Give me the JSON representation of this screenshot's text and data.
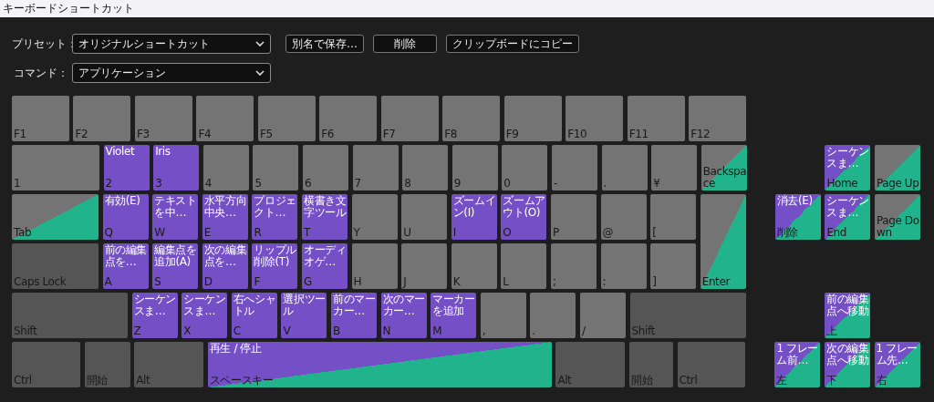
{
  "window": {
    "title": "キーボードショートカット"
  },
  "preset": {
    "label": "プリセット：",
    "value": "オリジナルショートカット"
  },
  "buttons": [
    "別名で保存…",
    "削除",
    "クリップボードにコピー"
  ],
  "command": {
    "label": "コマンド：",
    "value": "アプリケーション"
  },
  "keyboard": {
    "rows": [
      {
        "keys": [
          {
            "key": "F1",
            "kind": "plain"
          },
          {
            "key": "F2",
            "kind": "plain"
          },
          {
            "key": "F3",
            "kind": "plain"
          },
          {
            "key": "F4",
            "kind": "plain"
          },
          {
            "key": "F5",
            "kind": "plain"
          },
          {
            "key": "F6",
            "kind": "plain"
          },
          {
            "key": "F7",
            "kind": "plain"
          },
          {
            "key": "F8",
            "kind": "plain"
          },
          {
            "key": "F9",
            "kind": "plain"
          },
          {
            "key": "F10",
            "kind": "plain"
          },
          {
            "key": "F11",
            "kind": "plain"
          },
          {
            "key": "F12",
            "kind": "plain"
          }
        ]
      },
      {
        "keys": [
          {
            "key": "1",
            "kind": "plain"
          },
          {
            "key": "2",
            "kind": "app",
            "command": "Violet"
          },
          {
            "key": "3",
            "kind": "app",
            "command": "Iris"
          },
          {
            "key": "4",
            "kind": "plain"
          },
          {
            "key": "5",
            "kind": "plain"
          },
          {
            "key": "6",
            "kind": "plain"
          },
          {
            "key": "7",
            "kind": "plain"
          },
          {
            "key": "8",
            "kind": "plain"
          },
          {
            "key": "9",
            "kind": "plain"
          },
          {
            "key": "0",
            "kind": "plain"
          },
          {
            "key": "-",
            "kind": "plain"
          },
          {
            "key": ".",
            "kind": "plain"
          },
          {
            "key": "¥",
            "kind": "plain"
          },
          {
            "key": "Backspace",
            "kind": "panel"
          }
        ]
      },
      {
        "keys": [
          {
            "key": "Tab",
            "kind": "panel"
          },
          {
            "key": "Q",
            "kind": "app",
            "command": "有効(E)"
          },
          {
            "key": "W",
            "kind": "app",
            "command": "テキストを中…"
          },
          {
            "key": "E",
            "kind": "app",
            "command": "水平方向中央…"
          },
          {
            "key": "R",
            "kind": "app",
            "command": "プロジェクト…"
          },
          {
            "key": "T",
            "kind": "app",
            "command": "横書き文字ツール"
          },
          {
            "key": "Y",
            "kind": "plain"
          },
          {
            "key": "U",
            "kind": "plain"
          },
          {
            "key": "I",
            "kind": "app",
            "command": "ズームイン(I)"
          },
          {
            "key": "O",
            "kind": "app",
            "command": "ズームアウト(O)"
          },
          {
            "key": "P",
            "kind": "plain"
          },
          {
            "key": "@",
            "kind": "plain"
          },
          {
            "key": "[",
            "kind": "plain"
          },
          {
            "key": "Enter",
            "kind": "panel"
          }
        ]
      },
      {
        "keys": [
          {
            "key": "Caps Lock",
            "kind": "modifier"
          },
          {
            "key": "A",
            "kind": "app",
            "command": "前の編集点を…"
          },
          {
            "key": "S",
            "kind": "app",
            "command": "編集点を追加(A)"
          },
          {
            "key": "D",
            "kind": "app",
            "command": "次の編集点を…"
          },
          {
            "key": "F",
            "kind": "app",
            "command": "リップル削除(T)"
          },
          {
            "key": "G",
            "kind": "app",
            "command": "オーディオゲ…"
          },
          {
            "key": "H",
            "kind": "plain"
          },
          {
            "key": "J",
            "kind": "plain"
          },
          {
            "key": "K",
            "kind": "plain"
          },
          {
            "key": "L",
            "kind": "plain"
          },
          {
            "key": ";",
            "kind": "plain"
          },
          {
            "key": ":",
            "kind": "plain"
          },
          {
            "key": "]",
            "kind": "plain"
          }
        ]
      },
      {
        "keys": [
          {
            "key": "Shift",
            "kind": "modifier"
          },
          {
            "key": "Z",
            "kind": "app",
            "command": "シーケンスま…"
          },
          {
            "key": "X",
            "kind": "app",
            "command": "シーケンスま…"
          },
          {
            "key": "C",
            "kind": "app",
            "command": "右へシャトル"
          },
          {
            "key": "V",
            "kind": "app",
            "command": "選択ツール"
          },
          {
            "key": "B",
            "kind": "app",
            "command": "前のマーカー…"
          },
          {
            "key": "N",
            "kind": "app",
            "command": "次のマーカー…"
          },
          {
            "key": "M",
            "kind": "app",
            "command": "マーカーを追加"
          },
          {
            "key": ",",
            "kind": "plain"
          },
          {
            "key": ".",
            "kind": "plain"
          },
          {
            "key": "/",
            "kind": "plain"
          },
          {
            "key": "Shift",
            "kind": "modifier"
          }
        ]
      },
      {
        "keys": [
          {
            "key": "Ctrl",
            "kind": "modifier"
          },
          {
            "key": "開始",
            "kind": "modifier"
          },
          {
            "key": "Alt",
            "kind": "modifier"
          },
          {
            "key": "スペースキー",
            "kind": "app_panel",
            "command": "再生 / 停止"
          },
          {
            "key": "Alt",
            "kind": "modifier"
          },
          {
            "key": "開始",
            "kind": "modifier"
          },
          {
            "key": "Ctrl",
            "kind": "modifier"
          }
        ]
      }
    ]
  },
  "edit_keys": {
    "rows": [
      {
        "keys": [
          {
            "key": "Home",
            "kind": "app_panel",
            "command": "シーケンスま…"
          },
          {
            "key": "Page Up",
            "kind": "panel"
          }
        ]
      },
      {
        "keys": [
          {
            "key": "削除",
            "kind": "app_panel",
            "command": "消去(E)"
          },
          {
            "key": "End",
            "kind": "app_panel",
            "command": "シーケンスま…"
          },
          {
            "key": "Page Down",
            "kind": "panel"
          }
        ]
      }
    ]
  },
  "arrow_keys": {
    "rows": [
      {
        "keys": [
          {
            "key": "上",
            "kind": "app_panel",
            "command": "前の編集点へ移動"
          }
        ]
      },
      {
        "keys": [
          {
            "key": "左",
            "kind": "app_panel",
            "command": "1 フレーム前…"
          },
          {
            "key": "下",
            "kind": "app_panel",
            "command": "次の編集点へ移動"
          },
          {
            "key": "右",
            "kind": "app_panel",
            "command": "1 フレーム先…"
          }
        ]
      }
    ]
  }
}
